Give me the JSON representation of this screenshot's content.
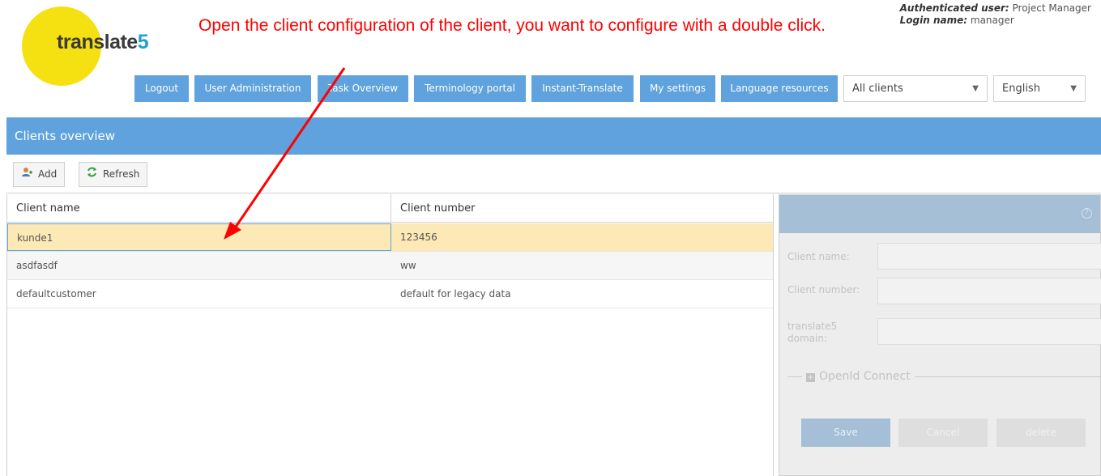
{
  "logo": {
    "text_main": "translate",
    "text_accent": "5"
  },
  "annotation": {
    "text": "Open the client configuration of the client, you want to configure with a double click."
  },
  "auth": {
    "user_label": "Authenticated user:",
    "user_value": "Project Manager",
    "login_label": "Login name:",
    "login_value": "manager"
  },
  "nav": {
    "logout": "Logout",
    "user_admin": "User Administration",
    "task_overview": "Task Overview",
    "terminology": "Terminology portal",
    "instant_translate": "Instant-Translate",
    "my_settings": "My settings",
    "language_resources": "Language resources"
  },
  "selectors": {
    "clients": "All clients",
    "language": "English"
  },
  "panel": {
    "title": "Clients overview"
  },
  "toolbar": {
    "add": "Add",
    "refresh": "Refresh"
  },
  "grid": {
    "columns": [
      "Client name",
      "Client number"
    ],
    "rows": [
      {
        "name": "kunde1",
        "number": "123456"
      },
      {
        "name": "asdfasdf",
        "number": "ww"
      },
      {
        "name": "defaultcustomer",
        "number": "default for legacy data"
      }
    ]
  },
  "detail": {
    "help": "?",
    "client_name_label": "Client name:",
    "client_number_label": "Client number:",
    "domain_label": "translate5 domain:",
    "openid_label": "OpenId Connect",
    "save": "Save",
    "cancel": "Cancel",
    "delete": "delete"
  },
  "colors": {
    "accent": "#5fa2dd",
    "selected_row": "#fde9b6",
    "logo_yellow": "#f5e012",
    "annotation_red": "#ff0000"
  }
}
